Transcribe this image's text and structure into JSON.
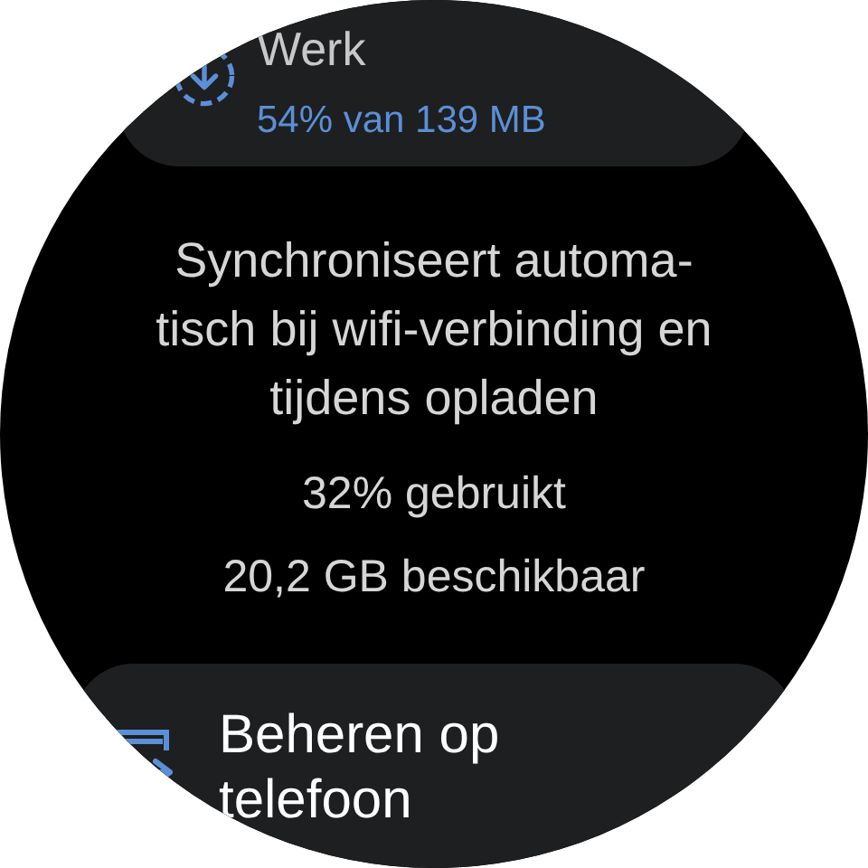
{
  "top_item": {
    "title": "Werk",
    "subtitle": "54% van 139 MB"
  },
  "sync_info": "Synchroniseert automa-\ntisch bij wifi-verbinding en\ntijdens opladen",
  "storage": {
    "used": "32% gebruikt",
    "available": "20,2 GB beschikbaar"
  },
  "bottom_item": {
    "label": "Beheren op\ntelefoon"
  }
}
